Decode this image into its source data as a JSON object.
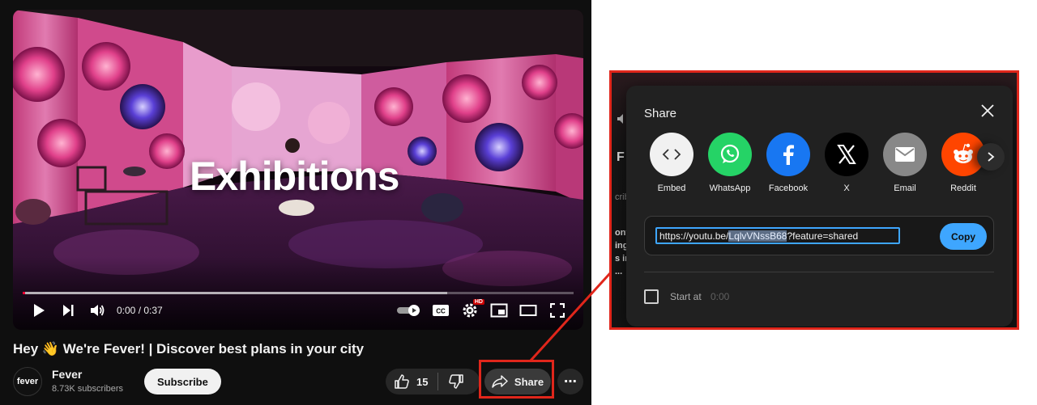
{
  "player": {
    "overlay_text": "Exhibitions",
    "time_display": "0:00 / 0:37",
    "hd_badge": "HD",
    "progress_played_fraction": 0.005,
    "progress_buffered_fraction": 0.77
  },
  "video": {
    "title": "Hey 👋 We're Fever! | Discover best plans in your city"
  },
  "channel": {
    "avatar_text": "fever",
    "name": "Fever",
    "subscribers": "8.73K subscribers",
    "subscribe_label": "Subscribe"
  },
  "actions": {
    "like_count": "15",
    "share_label": "Share",
    "more_label": "⋯"
  },
  "share_dialog": {
    "title": "Share",
    "targets": [
      {
        "label": "Embed",
        "icon": "embed-icon",
        "color": "#f1f1f1"
      },
      {
        "label": "WhatsApp",
        "icon": "whatsapp-icon",
        "color": "#25d366"
      },
      {
        "label": "Facebook",
        "icon": "facebook-icon",
        "color": "#1877f2"
      },
      {
        "label": "X",
        "icon": "x-icon",
        "color": "#000000"
      },
      {
        "label": "Email",
        "icon": "email-icon",
        "color": "#888888"
      },
      {
        "label": "Reddit",
        "icon": "reddit-icon",
        "color": "#ff4500"
      }
    ],
    "url_prefix": "https://youtu.be/",
    "url_selected": "LqlvVNssB68",
    "url_suffix": "?feature=shared",
    "copy_label": "Copy",
    "start_at_label": "Start at",
    "start_at_time": "0:00"
  },
  "zoom_background": {
    "glyph_2": "F",
    "glyph_3": "cribi",
    "glyph_4": "ontl\ning\ns in\n..."
  },
  "colors": {
    "highlight": "#e0261b",
    "accent_blue": "#3ea6ff",
    "progress_red": "#ff0033"
  }
}
